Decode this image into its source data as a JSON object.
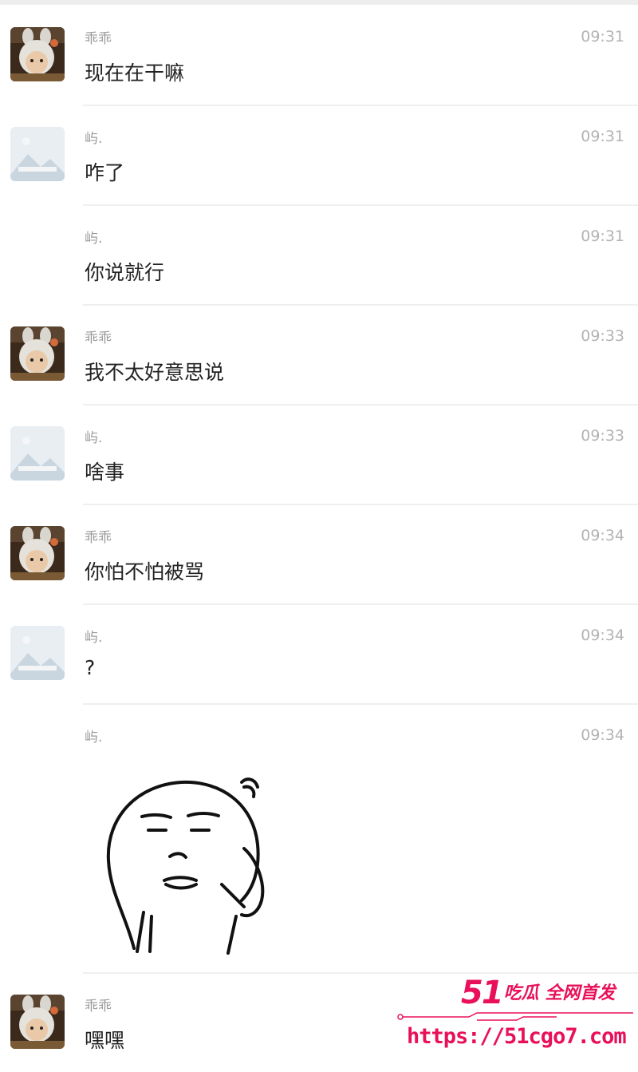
{
  "messages": [
    {
      "sender": "乖乖",
      "time": "09:31",
      "text": "现在在干嘛",
      "avatar": "cartoon-avatar"
    },
    {
      "sender": "屿.",
      "time": "09:31",
      "text": "咋了",
      "avatar": "landscape-avatar"
    },
    {
      "sender": "屿.",
      "time": "09:31",
      "text": "你说就行",
      "avatar": ""
    },
    {
      "sender": "乖乖",
      "time": "09:33",
      "text": "我不太好意思说",
      "avatar": "cartoon-avatar"
    },
    {
      "sender": "屿.",
      "time": "09:33",
      "text": "啥事",
      "avatar": "landscape-avatar"
    },
    {
      "sender": "乖乖",
      "time": "09:34",
      "text": "你怕不怕被骂",
      "avatar": "cartoon-avatar"
    },
    {
      "sender": "屿.",
      "time": "09:34",
      "text": "?",
      "avatar": "landscape-avatar"
    },
    {
      "sender": "屿.",
      "time": "09:34",
      "text": "",
      "avatar": "",
      "sticker": "thinking-face-sticker"
    },
    {
      "sender": "乖乖",
      "time": "",
      "text": "嘿嘿",
      "avatar": "cartoon-avatar"
    }
  ],
  "watermark": {
    "number": "51",
    "slogan": "吃瓜 全网首发",
    "url": "https://51cgo7.com"
  },
  "colors": {
    "name": "#9b9b9b",
    "time": "#b3b3b3",
    "text": "#222222",
    "watermark": "#e8105a"
  }
}
